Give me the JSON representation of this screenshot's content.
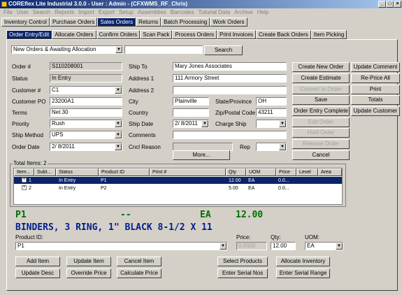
{
  "window": {
    "title": "COREflex Lite Industrial 3.0.0 - User : Admin - (CFXWMS_RF_Chris)"
  },
  "menu": [
    "File",
    "User",
    "Search",
    "Reports",
    "Import",
    "Export",
    "Setup",
    "Assemblies",
    "Barcodes",
    "Tutorial Data",
    "Archive",
    "Help"
  ],
  "main_tabs": [
    "Inventory Control",
    "Purchase Orders",
    "Sales Orders",
    "Returns",
    "Batch Processing",
    "Work Orders"
  ],
  "sub_tabs": [
    "Order Entry/Edit",
    "Allocate Orders",
    "Confirm Orders",
    "Scan Pack",
    "Process Orders",
    "Print Invoices",
    "Create Back Orders",
    "Item Picking"
  ],
  "filter": {
    "value": "New Orders & Awaiting Allocation",
    "search_value": "",
    "search_label": "Search"
  },
  "form": {
    "order_no_label": "Order #",
    "order_no": "S110208001",
    "status_label": "Status",
    "status": "In Entry",
    "customer_label": "Customer #",
    "customer": "C1",
    "customer_po_label": "Customer PO",
    "customer_po": "23200A1",
    "terms_label": "Terms",
    "terms": "Net 30",
    "priority_label": "Priority",
    "priority": "Rush",
    "ship_method_label": "Ship Method",
    "ship_method": "UPS",
    "order_date_label": "Order Date",
    "order_date": "2/  8/2011",
    "ship_to_label": "Ship To",
    "ship_to": "Mary Jones Associates",
    "address1_label": "Address 1",
    "address1": "111 Armory Street",
    "address2_label": "Address 2",
    "address2": "",
    "city_label": "City",
    "city": "Plainville",
    "state_label": "State/Province",
    "state": "OH",
    "country_label": "Country",
    "country": "",
    "zip_label": "Zip/Postal Code",
    "zip": "43211",
    "ship_date_label": "Ship Date",
    "ship_date": "2/  8/2011",
    "charge_ship_label": "Charge Ship",
    "charge_ship": "",
    "comments_label": "Comments",
    "comments": "",
    "cncl_reason_label": "Cncl Reason",
    "cncl_reason": "",
    "rep_label": "Rep",
    "rep": "",
    "more_label": "More..."
  },
  "right_buttons": {
    "create_new_order": "Create New Order",
    "update_comment": "Update Comment",
    "create_estimate": "Create Estimate",
    "reprice_all": "Re-Price All",
    "convert_to_order": "Convert to Order",
    "print": "Print",
    "save": "Save",
    "totals": "Totals",
    "order_entry_complete": "Order Entry Complete",
    "update_customer": "Update Customer",
    "edit_order": "Edit Order",
    "hold_order": "Hold Order",
    "release_order": "Release Order",
    "cancel": "Cancel"
  },
  "items": {
    "total_label": "Total Items: 2",
    "columns": [
      "Item...",
      "Subt...",
      "Status",
      "Product ID",
      "Print #",
      "Qty",
      "UOM",
      "Price",
      "Level",
      "Area"
    ],
    "rows": [
      {
        "item": "1",
        "status": "In Entry",
        "product": "P1",
        "qty": "12.00",
        "uom": "EA",
        "price": "0.0..."
      },
      {
        "item": "2",
        "status": "In Entry",
        "product": "P2",
        "qty": "5.00",
        "uom": "EA",
        "price": "0.0..."
      }
    ]
  },
  "detail": {
    "product": "P1",
    "dashes": "--",
    "uom": "EA",
    "qty": "12.00",
    "description": "BINDERS, 3 RING, 1\" BLACK 8-1/2 X 11"
  },
  "entry": {
    "product_label": "Product ID:",
    "product": "P1",
    "price_label": "Price:",
    "price": "0.0000",
    "qty_label": "Qty:",
    "qty": "12.00",
    "uom_label": "UOM:",
    "uom": "EA"
  },
  "bottom_buttons": {
    "add_item": "Add Item",
    "update_item": "Update Item",
    "cancel_item": "Cancel Item",
    "select_products": "Select Products",
    "allocate_inventory": "Allocate Inventory",
    "update_desc": "Update Desc",
    "override_price": "Override Price",
    "calculate_price": "Calculate Price",
    "enter_serial_nos": "Enter Serial Nos",
    "enter_serial_range": "Enter Serial Range"
  }
}
